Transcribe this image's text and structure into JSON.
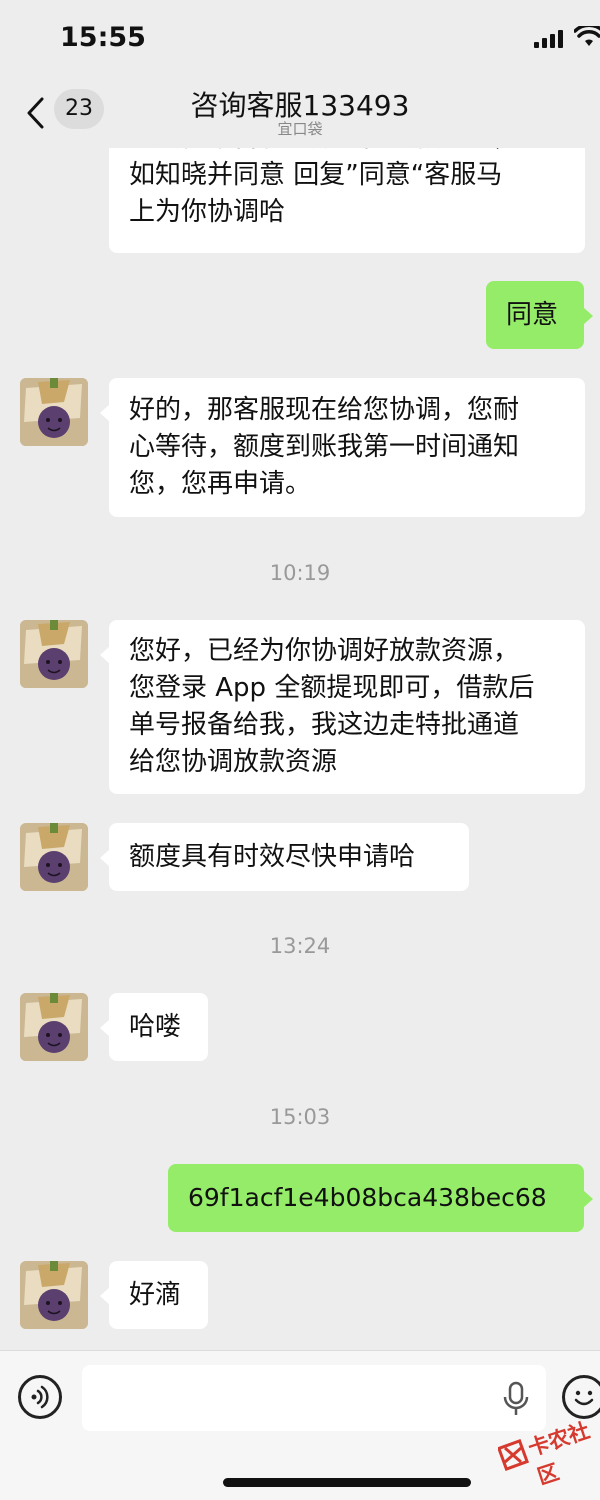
{
  "status_bar": {
    "time": "15:55"
  },
  "nav": {
    "unread_count": "23",
    "title": "咨询客服133493",
    "subtitle": "宜口袋"
  },
  "messages": {
    "m1": {
      "line1": "或其他平台有逾期可能会被划扣，",
      "line2": "如知晓并同意 回复”同意“客服马",
      "line3": "上为你协调哈"
    },
    "m2": "同意",
    "m3": {
      "line1": "好的，那客服现在给您协调，您耐",
      "line2": "心等待，额度到账我第一时间通知",
      "line3": "您，您再申请。"
    },
    "t1": "10:19",
    "m4": {
      "line1": "您好，已经为你协调好放款资源，",
      "line2": "您登录 App 全额提现即可，借款后",
      "line3": "单号报备给我，我这边走特批通道",
      "line4": "给您协调放款资源"
    },
    "m5": "额度具有时效尽快申请哈",
    "t2": "13:24",
    "m6": "哈喽",
    "t3": "15:03",
    "m7": "69f1acf1e4b08bca438bec68",
    "m8": "好滴"
  },
  "watermark": {
    "text": "卡农社区"
  },
  "colors": {
    "background": "#ededed",
    "self_bubble": "#95ec69",
    "other_bubble": "#ffffff",
    "timestamp": "#999999",
    "watermark": "#d63a2e"
  },
  "icons": [
    "back-chevron-icon",
    "signal-icon",
    "wifi-icon",
    "voice-icon",
    "microphone-icon",
    "emoji-icon"
  ]
}
